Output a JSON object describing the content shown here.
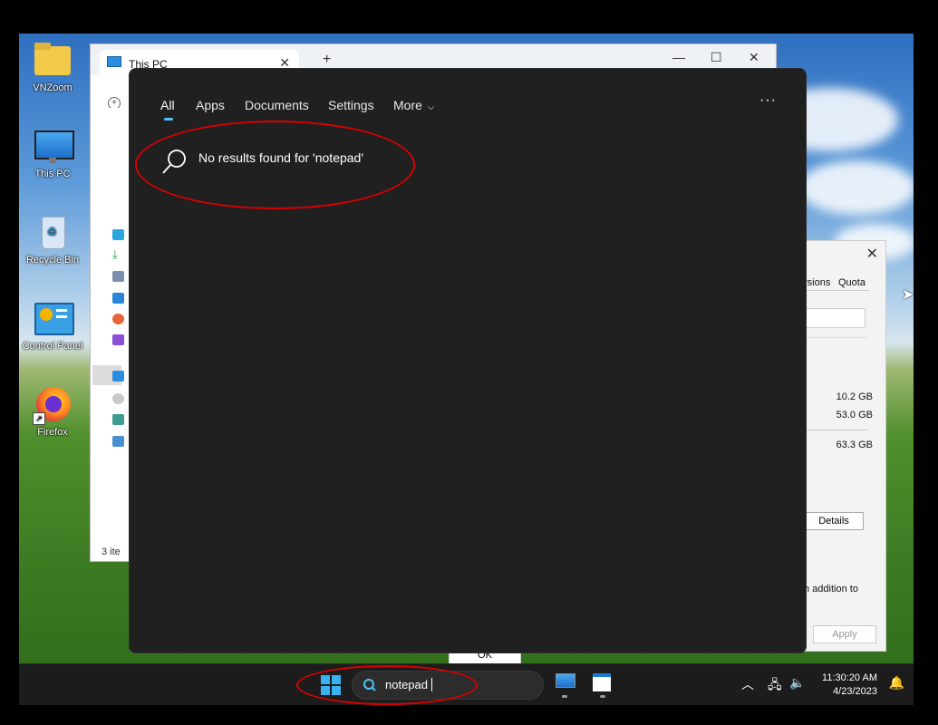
{
  "desktop": {
    "icons": [
      {
        "label": "VNZoom"
      },
      {
        "label": "This PC"
      },
      {
        "label": "Recycle Bin"
      },
      {
        "label": "Control Panel"
      },
      {
        "label": "Firefox"
      }
    ]
  },
  "explorer": {
    "tab_title": "This PC",
    "status_text": "3 ite"
  },
  "properties": {
    "tabs": [
      "rsions",
      "Quota"
    ],
    "values": [
      "10.2 GB",
      "53.0 GB",
      "63.3 GB"
    ],
    "details_button": "Details",
    "partial_text": "n addition to",
    "apply_button": "Apply",
    "ok_button": "OK"
  },
  "search_panel": {
    "tabs": [
      {
        "label": "All",
        "active": true
      },
      {
        "label": "Apps"
      },
      {
        "label": "Documents"
      },
      {
        "label": "Settings"
      },
      {
        "label": "More"
      }
    ],
    "more_menu_icon": "ellipsis-icon",
    "no_results_text": "No results found for 'notepad'",
    "accent_color": "#4cc2ff"
  },
  "taskbar": {
    "search_value": "notepad",
    "clock_time": "11:30:20 AM",
    "clock_date": "4/23/2023"
  },
  "annotations": {
    "highlight_color": "#d80000"
  }
}
